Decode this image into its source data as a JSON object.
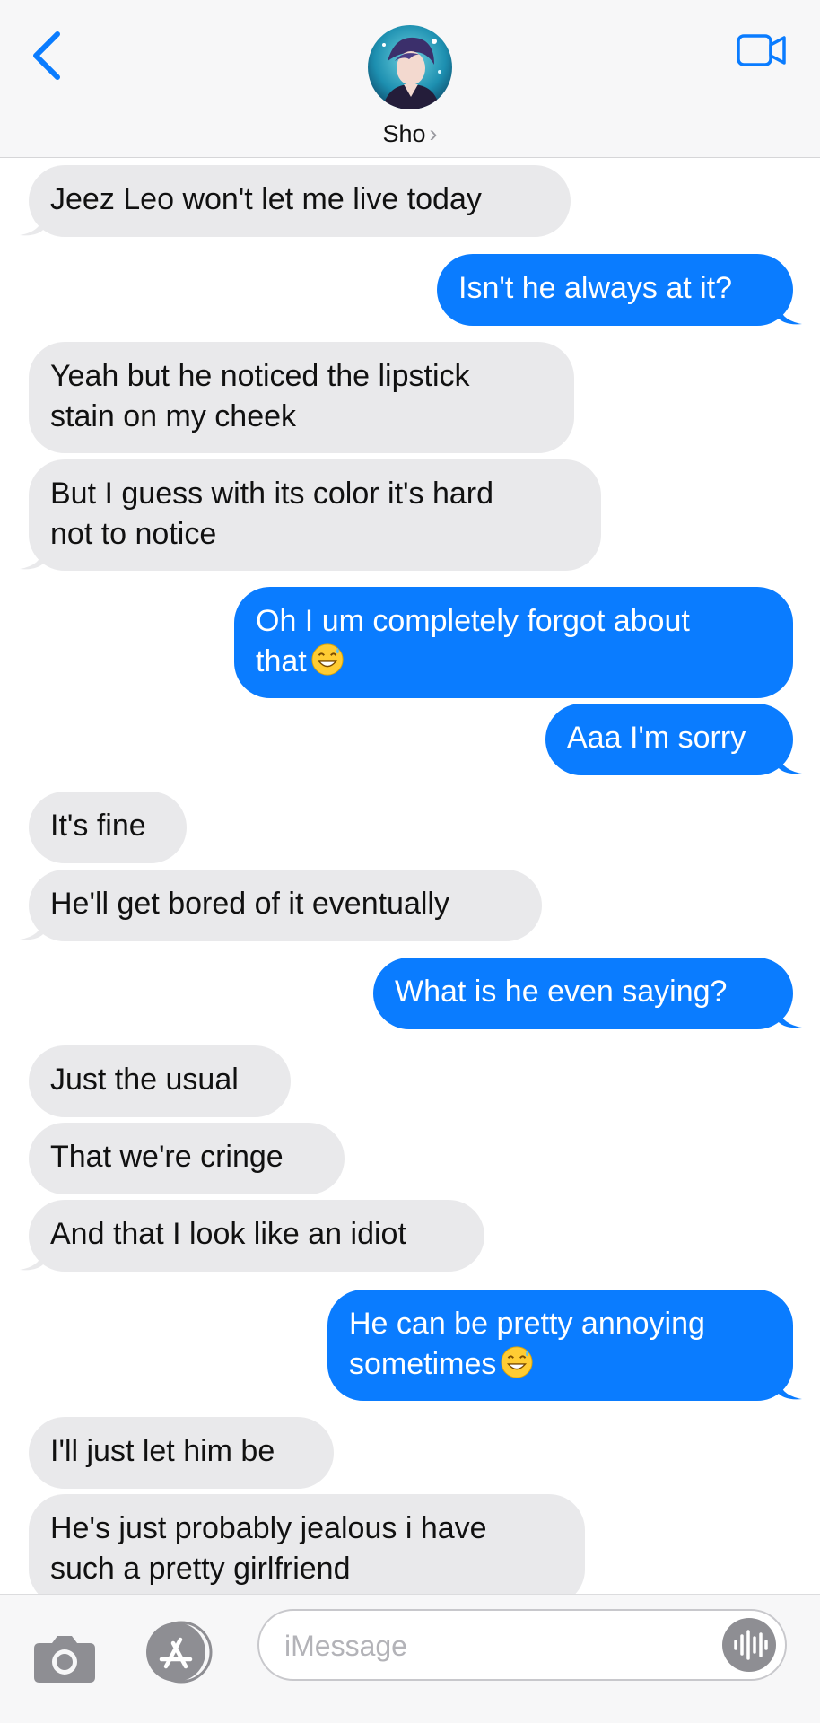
{
  "header": {
    "contact_name": "Sho",
    "name_chevron": "›",
    "icons": {
      "back": "chevron-left-icon",
      "video": "video-camera-icon"
    },
    "accent_color": "#0a7cff"
  },
  "messages": [
    {
      "from": "them",
      "text": "Jeez Leo won't let me live today"
    },
    {
      "from": "me",
      "text": "Isn't he always at it?"
    },
    {
      "from": "them",
      "lines": [
        "Yeah but he noticed the lipstick",
        "stain on my cheek"
      ]
    },
    {
      "from": "them",
      "lines": [
        "But I guess with its color it's hard",
        "not to notice"
      ]
    },
    {
      "from": "me",
      "lines": [
        "Oh I um completely forgot about",
        "that"
      ],
      "emoji": "grinning-sweat-emoji"
    },
    {
      "from": "me",
      "text": "Aaa I'm sorry"
    },
    {
      "from": "them",
      "text": "It's fine"
    },
    {
      "from": "them",
      "text": "He'll get bored of it eventually"
    },
    {
      "from": "me",
      "text": "What is he even saying?"
    },
    {
      "from": "them",
      "text": "Just the usual"
    },
    {
      "from": "them",
      "text": "That we're cringe"
    },
    {
      "from": "them",
      "text": "And that I look like an idiot"
    },
    {
      "from": "me",
      "lines": [
        "He can be pretty annoying",
        "sometimes"
      ],
      "emoji": "grinning-sweat-emoji"
    },
    {
      "from": "them",
      "text": "I'll just let him be"
    },
    {
      "from": "them",
      "lines": [
        "He's just probably jealous i have",
        "such a pretty girlfriend"
      ]
    }
  ],
  "colors": {
    "incoming_bubble": "#e9e9eb",
    "outgoing_bubble": "#0a7cff"
  },
  "input": {
    "placeholder": "iMessage",
    "icons": {
      "camera": "camera-icon",
      "apps": "app-store-icon",
      "audio": "audio-waveform-icon"
    }
  }
}
